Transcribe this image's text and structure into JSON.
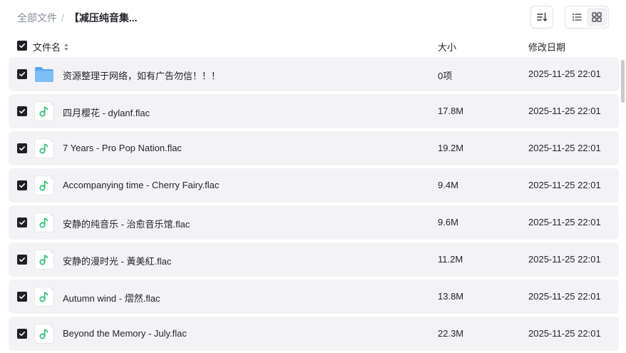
{
  "breadcrumb": {
    "root": "全部文件",
    "separator": "/",
    "current": "【减压纯音集..."
  },
  "columns": {
    "name": "文件名",
    "size": "大小",
    "modified": "修改日期"
  },
  "colors": {
    "checkbox": "#1f2024",
    "row_bg": "#f3f3f5",
    "audio_icon": "#3bc17a",
    "folder_icon": "#6cb4f2"
  },
  "files": [
    {
      "icon": "folder-icon",
      "name": "资源整理于网络，如有广告勿信！！！",
      "size": "0项",
      "date": "2025-11-25 22:01"
    },
    {
      "icon": "audio-file-icon",
      "name": "四月樱花 - dylanf.flac",
      "size": "17.8M",
      "date": "2025-11-25 22:01"
    },
    {
      "icon": "audio-file-icon",
      "name": "7 Years - Pro Pop Nation.flac",
      "size": "19.2M",
      "date": "2025-11-25 22:01"
    },
    {
      "icon": "audio-file-icon",
      "name": "Accompanying time - Cherry Fairy.flac",
      "size": "9.4M",
      "date": "2025-11-25 22:01"
    },
    {
      "icon": "audio-file-icon",
      "name": "安静的纯音乐 - 治愈音乐馆.flac",
      "size": "9.6M",
      "date": "2025-11-25 22:01"
    },
    {
      "icon": "audio-file-icon",
      "name": "安静的漫时光 - 黃美紅.flac",
      "size": "11.2M",
      "date": "2025-11-25 22:01"
    },
    {
      "icon": "audio-file-icon",
      "name": "Autumn wind - 熠然.flac",
      "size": "13.8M",
      "date": "2025-11-25 22:01"
    },
    {
      "icon": "audio-file-icon",
      "name": "Beyond the Memory - July.flac",
      "size": "22.3M",
      "date": "2025-11-25 22:01"
    }
  ]
}
